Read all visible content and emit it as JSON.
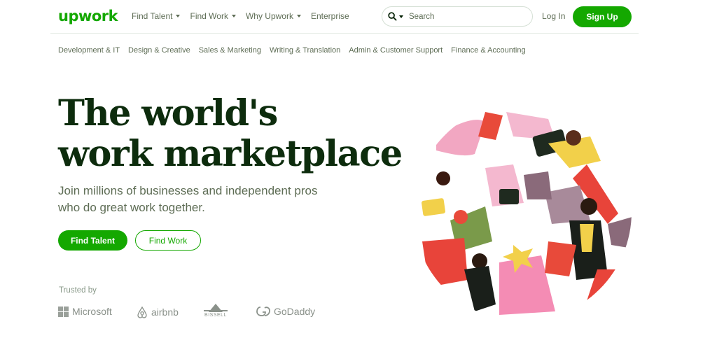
{
  "header": {
    "logo": "upwork",
    "nav": [
      {
        "label": "Find Talent",
        "has_dropdown": true
      },
      {
        "label": "Find Work",
        "has_dropdown": true
      },
      {
        "label": "Why Upwork",
        "has_dropdown": true
      },
      {
        "label": "Enterprise",
        "has_dropdown": false
      }
    ],
    "search": {
      "placeholder": "Search",
      "icon": "search-icon"
    },
    "login": "Log In",
    "signup": "Sign Up"
  },
  "categories": [
    "Development & IT",
    "Design & Creative",
    "Sales & Marketing",
    "Writing & Translation",
    "Admin & Customer Support",
    "Finance & Accounting"
  ],
  "hero": {
    "title_line1": "The world's",
    "title_line2": "work marketplace",
    "subtitle": "Join millions of businesses and independent pros who do great work together.",
    "cta_primary": "Find Talent",
    "cta_secondary": "Find Work"
  },
  "trusted": {
    "label": "Trusted by",
    "brands": [
      "Microsoft",
      "airbnb",
      "BISSELL",
      "GoDaddy"
    ]
  },
  "colors": {
    "brand_green": "#14a800",
    "heading": "#0d2c0d",
    "muted": "#5e6d55"
  }
}
